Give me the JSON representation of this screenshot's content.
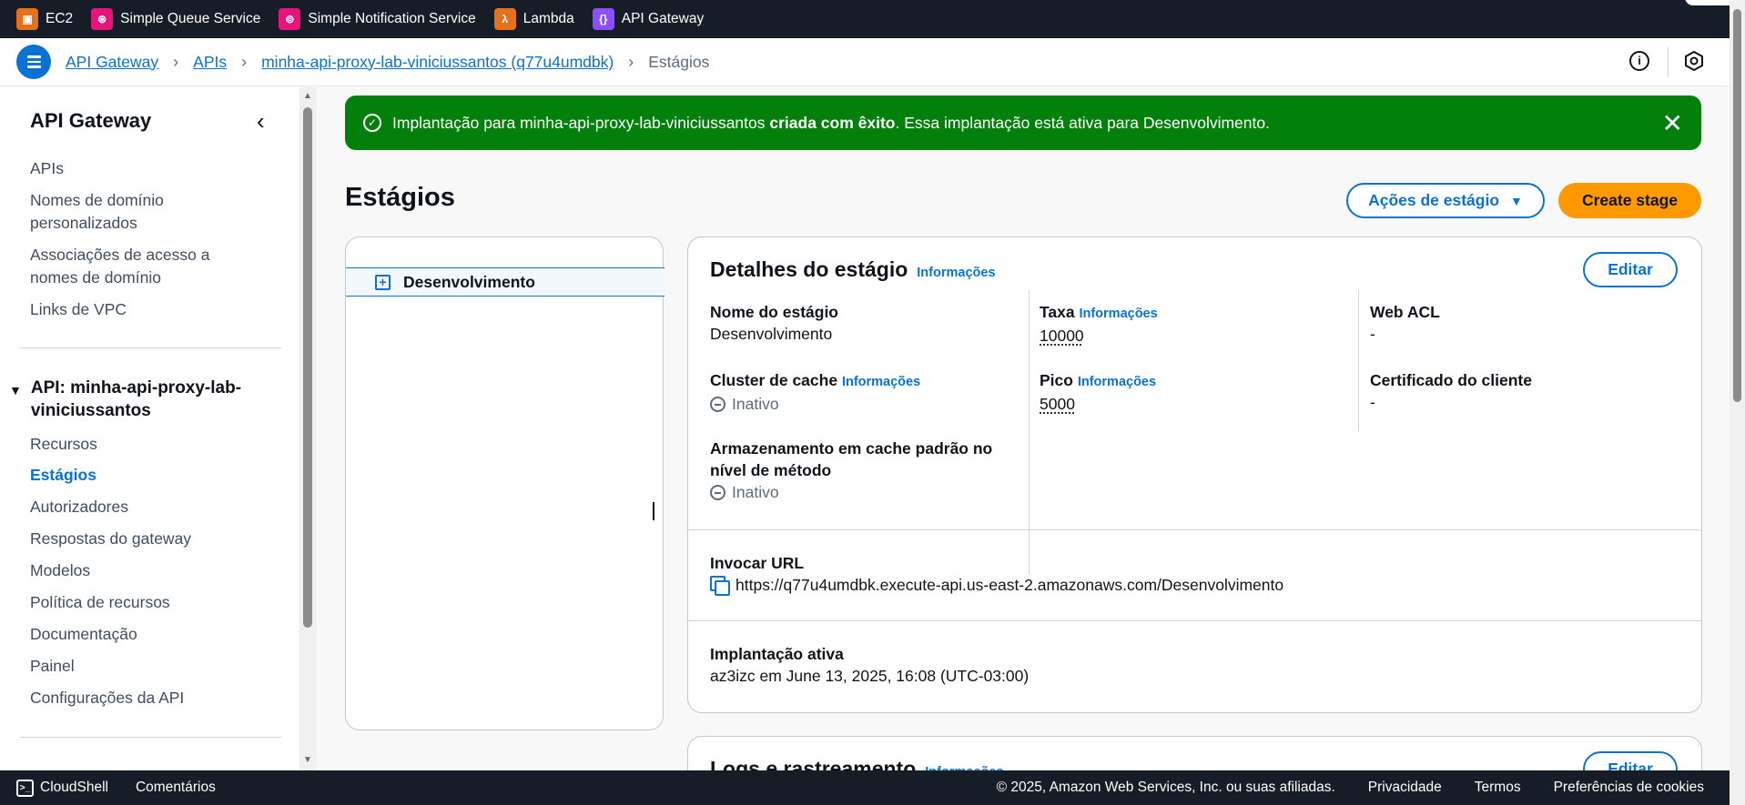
{
  "favorites": [
    {
      "label": "EC2",
      "icon": "ec2-icon"
    },
    {
      "label": "Simple Queue Service",
      "icon": "sqs-icon"
    },
    {
      "label": "Simple Notification Service",
      "icon": "sns-icon"
    },
    {
      "label": "Lambda",
      "icon": "lambda-icon"
    },
    {
      "label": "API Gateway",
      "icon": "api-gateway-icon"
    }
  ],
  "breadcrumb": {
    "items": [
      "API Gateway",
      "APIs",
      "minha-api-proxy-lab-viniciussantos (q77u4umdbk)"
    ],
    "current": "Estágios"
  },
  "sidebar": {
    "title": "API Gateway",
    "top_items": [
      "APIs",
      "Nomes de domínio personalizados",
      "Associações de acesso a nomes de domínio",
      "Links de VPC"
    ],
    "api_section": "API: minha-api-proxy-lab-viniciussantos",
    "api_items": [
      "Recursos",
      "Estágios",
      "Autorizadores",
      "Respostas do gateway",
      "Modelos",
      "Política de recursos",
      "Documentação",
      "Painel",
      "Configurações da API"
    ],
    "active_item": "Estágios"
  },
  "flash": {
    "prefix": "Implantação para minha-api-proxy-lab-viniciussantos ",
    "bold": "criada com êxito",
    "suffix": ". Essa implantação está ativa para Desenvolvimento.",
    "color": "#037f0c"
  },
  "page": {
    "title": "Estágios",
    "actions_label": "Ações de estágio",
    "create_label": "Create stage"
  },
  "tree": {
    "stage": "Desenvolvimento"
  },
  "details": {
    "title": "Detalhes do estágio",
    "info": "Informações",
    "edit": "Editar",
    "stage_name_label": "Nome do estágio",
    "stage_name_value": "Desenvolvimento",
    "cache_cluster_label": "Cluster de cache",
    "cache_cluster_value": "Inativo",
    "method_cache_label": "Armazenamento em cache padrão no nível de método",
    "method_cache_value": "Inativo",
    "rate_label": "Taxa",
    "rate_value": "10000",
    "burst_label": "Pico",
    "burst_value": "5000",
    "webacl_label": "Web ACL",
    "webacl_value": "-",
    "cert_label": "Certificado do cliente",
    "cert_value": "-",
    "invoke_label": "Invocar URL",
    "invoke_value": "https://q77u4umdbk.execute-api.us-east-2.amazonaws.com/Desenvolvimento",
    "deployment_label": "Implantação ativa",
    "deployment_value": "az3izc em June 13, 2025, 16:08 (UTC-03:00)"
  },
  "logs": {
    "title": "Logs e rastreamento",
    "info": "Informações",
    "edit": "Editar"
  },
  "footer": {
    "cloudshell": "CloudShell",
    "feedback": "Comentários",
    "copyright": "© 2025, Amazon Web Services, Inc. ou suas afiliadas.",
    "privacy": "Privacidade",
    "terms": "Termos",
    "cookies": "Preferências de cookies"
  },
  "colors": {
    "accent": "#0972d3",
    "primary_button": "#ff9900",
    "topbar": "#161d26"
  }
}
